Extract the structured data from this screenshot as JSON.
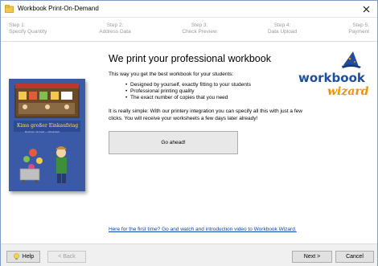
{
  "window": {
    "title": "Workbook Print-On-Demand"
  },
  "steps": [
    {
      "num": "Step 1:",
      "label": "Specify Quantity"
    },
    {
      "num": "Step 2:",
      "label": "Address Data"
    },
    {
      "num": "Step 3:",
      "label": "Check Preview"
    },
    {
      "num": "Step 4:",
      "label": "Data Upload"
    },
    {
      "num": "Step 5:",
      "label": "Payment"
    }
  ],
  "cover": {
    "title": "Kims großer Einkaufstag",
    "subtitle": "Rechnen mit Geld — Arbeitsheft"
  },
  "main": {
    "heading": "We print your professional workbook",
    "intro": "This way you get the best workbook for your students:",
    "bullets": [
      "Designed by yourself, exactly fitting to your students",
      "Professional printing quality",
      "The exact number of copies that you need"
    ],
    "body": "It is really simple: With our printery integration you can specify all this with just a few clicks. You will receive your worksheets a few days later already!",
    "go_button": "Go ahead!",
    "video_link": "Here for the first time? Go and watch and introduction video to Workbook Wizard."
  },
  "logo": {
    "line1": "workbook",
    "line2": "wizard"
  },
  "footer": {
    "help": "Help",
    "back": "< Back",
    "next": "Next >",
    "cancel": "Cancel"
  },
  "colors": {
    "link": "#0645ad",
    "logo_blue": "#1f4e9c",
    "logo_orange": "#f39200",
    "cover_blue": "#3a5aa8"
  }
}
